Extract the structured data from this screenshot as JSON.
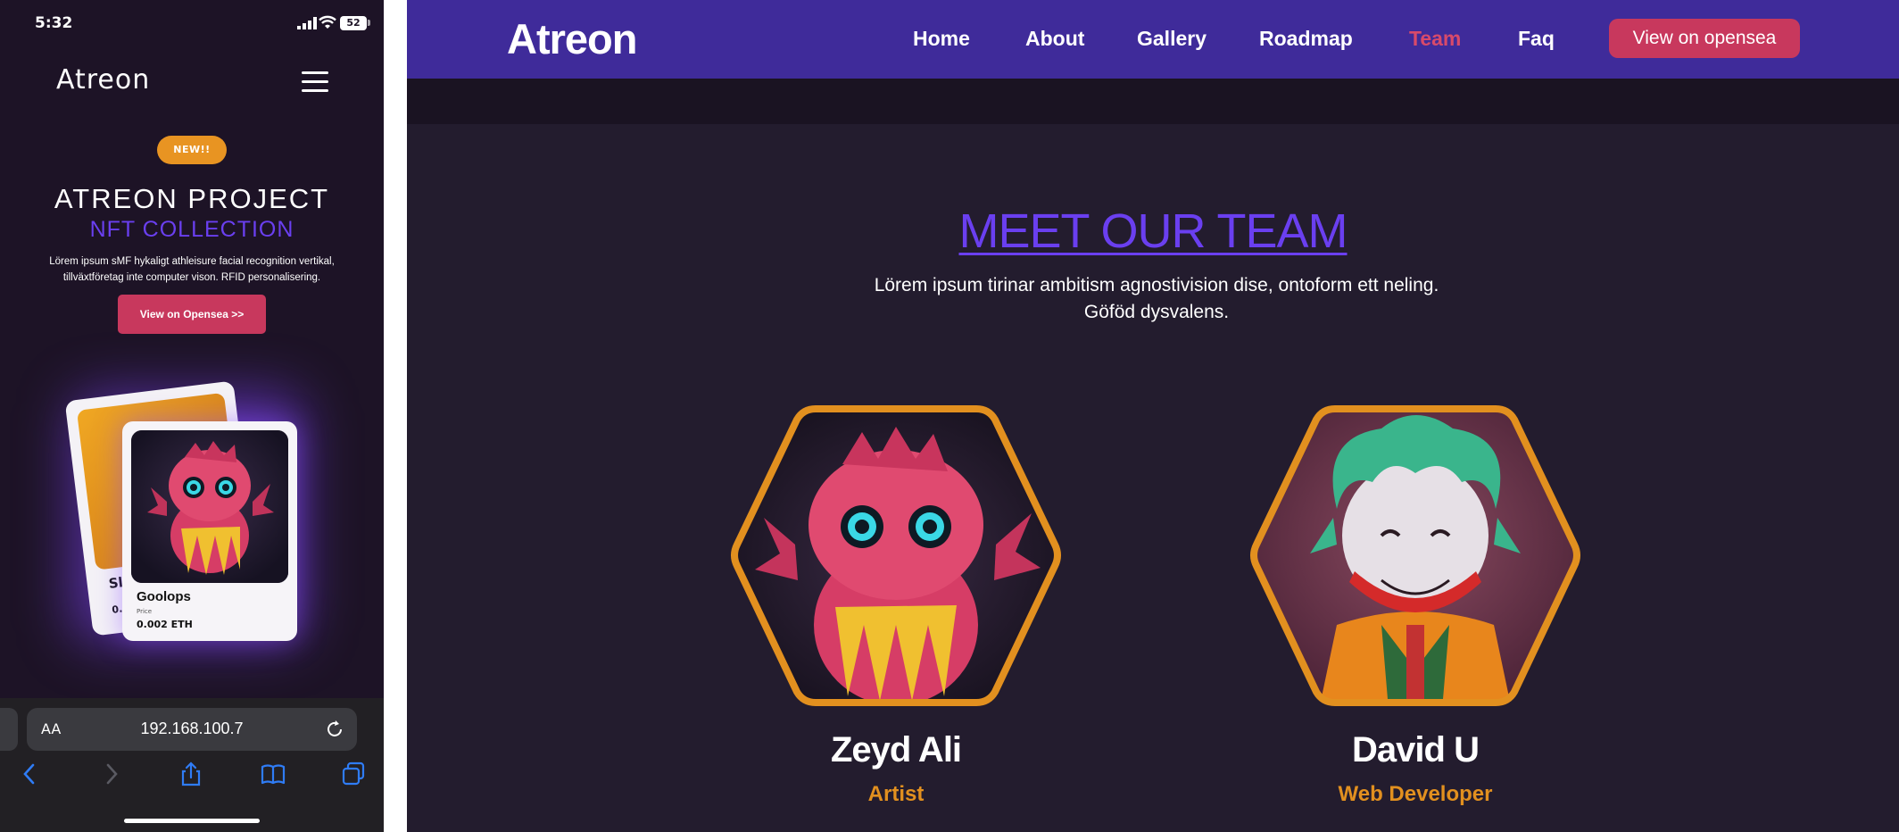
{
  "mobile": {
    "status": {
      "time": "5:32",
      "battery": "52"
    },
    "brand": "Atreon",
    "badge": "NEW!!",
    "title": "ATREON PROJECT",
    "subtitle": "NFT COLLECTION",
    "description": "Lörem ipsum sMF hykaligt athleisure facial recognition vertikal, tillväxtföretag inte computer vison. RFID personalisering.",
    "cta": "View on Opensea >>",
    "cards": {
      "back": {
        "name": "Sl",
        "price_partial": "0."
      },
      "front": {
        "name": "Goolops",
        "price_label": "Price",
        "price": "0.002 ETH"
      }
    },
    "browser": {
      "text_size": "AA",
      "url": "192.168.100.7"
    }
  },
  "desktop": {
    "brand": "Atreon",
    "nav": [
      {
        "label": "Home",
        "active": false
      },
      {
        "label": "About",
        "active": false
      },
      {
        "label": "Gallery",
        "active": false
      },
      {
        "label": "Roadmap",
        "active": false
      },
      {
        "label": "Team",
        "active": true
      },
      {
        "label": "Faq",
        "active": false
      }
    ],
    "cta": "View on opensea",
    "section_title": "MEET OUR TEAM",
    "section_desc": "Lörem ipsum tirinar ambitism agnostivision dise, ontoform ett neling. Göföd dysvalens.",
    "team": [
      {
        "name": "Zeyd Ali",
        "role": "Artist",
        "icon": "pink-monster-avatar"
      },
      {
        "name": "David U",
        "role": "Web Developer",
        "icon": "joker-avatar"
      }
    ]
  },
  "colors": {
    "accent_purple": "#6a3ff0",
    "nav_bg": "#3f2b9a",
    "button_pink": "#c8385d",
    "orange": "#e2901f",
    "page_bg": "#231c2e"
  }
}
